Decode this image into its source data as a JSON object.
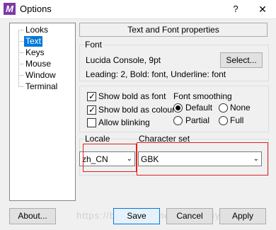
{
  "window": {
    "app_icon": "M",
    "title": "Options",
    "help_label": "?",
    "close_label": "✕"
  },
  "tree": {
    "items": [
      {
        "label": "Looks"
      },
      {
        "label": "Text"
      },
      {
        "label": "Keys"
      },
      {
        "label": "Mouse"
      },
      {
        "label": "Window"
      },
      {
        "label": "Terminal"
      }
    ],
    "selected": "Text"
  },
  "header": {
    "title": "Text and Font properties"
  },
  "font": {
    "group_title": "Font",
    "name": "Lucida Console, 9pt",
    "details": "Leading: 2, Bold: font, Underline: font",
    "select_label": "Select..."
  },
  "options": {
    "show_bold_as_font": {
      "label": "Show bold as font",
      "checked": true
    },
    "show_bold_as_colour": {
      "label": "Show bold as colour",
      "checked": true
    },
    "allow_blinking": {
      "label": "Allow blinking",
      "checked": false
    }
  },
  "smoothing": {
    "group_title": "Font smoothing",
    "options": [
      {
        "label": "Default",
        "selected": true
      },
      {
        "label": "None",
        "selected": false
      },
      {
        "label": "Partial",
        "selected": false
      },
      {
        "label": "Full",
        "selected": false
      }
    ]
  },
  "locale": {
    "group_title": "Locale",
    "value": "zh_CN"
  },
  "charset": {
    "group_title": "Character set",
    "value": "GBK"
  },
  "buttons": {
    "about": "About...",
    "save": "Save",
    "cancel": "Cancel",
    "apply": "Apply"
  },
  "watermark": "https://blog.csdn.net/wuyuzhiyi",
  "icons": {
    "checkmark": "✓",
    "chevron": "⌄"
  },
  "colors": {
    "selection": "#0078d7",
    "highlight_box": "#e02020",
    "app_icon": "#7a3aa8"
  }
}
